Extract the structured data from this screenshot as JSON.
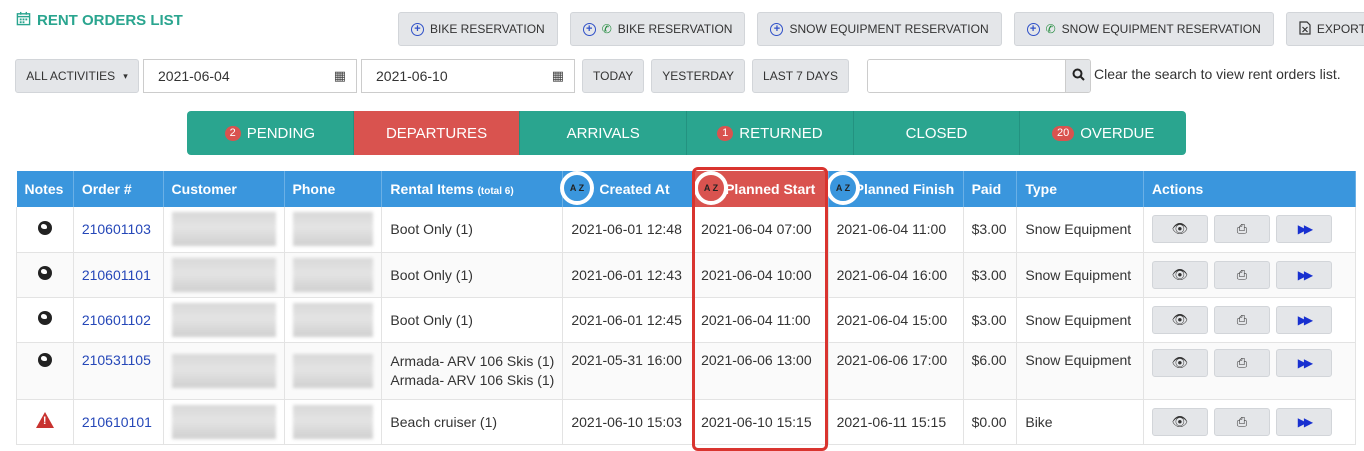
{
  "header": {
    "title": "RENT ORDERS LIST",
    "title_icon": "calendar-icon"
  },
  "top_actions": [
    {
      "label": "BIKE RESERVATION",
      "icons": [
        "plus-circle-icon"
      ]
    },
    {
      "label": "BIKE RESERVATION",
      "icons": [
        "plus-circle-icon",
        "phone-icon"
      ]
    },
    {
      "label": "SNOW EQUIPMENT RESERVATION",
      "icons": [
        "plus-circle-icon"
      ]
    },
    {
      "label": "SNOW EQUIPMENT RESERVATION",
      "icons": [
        "plus-circle-icon",
        "phone-icon"
      ]
    },
    {
      "label": "EXPORT",
      "icons": [
        "excel-icon"
      ]
    }
  ],
  "filters": {
    "activity_select": "ALL ACTIVITIES",
    "date_from": "2021-06-04",
    "date_to": "2021-06-10",
    "quick": [
      "TODAY",
      "YESTERDAY",
      "LAST 7 DAYS"
    ],
    "search_value": "",
    "search_hint": "Clear the search to view rent orders list."
  },
  "status_tabs": [
    {
      "label": "PENDING",
      "badge": "2",
      "active": false
    },
    {
      "label": "DEPARTURES",
      "badge": "",
      "active": true
    },
    {
      "label": "ARRIVALS",
      "badge": "",
      "active": false
    },
    {
      "label": "RETURNED",
      "badge": "1",
      "active": false
    },
    {
      "label": "CLOSED",
      "badge": "",
      "active": false
    },
    {
      "label": "OVERDUE",
      "badge": "20",
      "active": false
    }
  ],
  "table": {
    "columns": {
      "notes": "Notes",
      "order": "Order #",
      "customer": "Customer",
      "phone": "Phone",
      "rental_items": "Rental Items",
      "rental_items_total": "(total 6)",
      "created_at": "Created At",
      "planned_start": "Planned Start",
      "planned_finish": "Planned Finish",
      "paid": "Paid",
      "type": "Type",
      "actions": "Actions"
    },
    "sort_icon_text": "A Z",
    "rows": [
      {
        "note_icon": "globe-icon",
        "order": "210601103",
        "items": [
          "Boot Only (1)"
        ],
        "created": "2021-06-01 12:48",
        "start": "2021-06-04 07:00",
        "finish": "2021-06-04 11:00",
        "paid": "$3.00",
        "type": "Snow Equipment"
      },
      {
        "note_icon": "globe-icon",
        "order": "210601101",
        "items": [
          "Boot Only (1)"
        ],
        "created": "2021-06-01 12:43",
        "start": "2021-06-04 10:00",
        "finish": "2021-06-04 16:00",
        "paid": "$3.00",
        "type": "Snow Equipment"
      },
      {
        "note_icon": "globe-icon",
        "order": "210601102",
        "items": [
          "Boot Only (1)"
        ],
        "created": "2021-06-01 12:45",
        "start": "2021-06-04 11:00",
        "finish": "2021-06-04 15:00",
        "paid": "$3.00",
        "type": "Snow Equipment"
      },
      {
        "note_icon": "globe-icon",
        "order": "210531105",
        "items": [
          "Armada- ARV 106 Skis (1)",
          "Armada- ARV 106 Skis (1)"
        ],
        "created": "2021-05-31 16:00",
        "start": "2021-06-06 13:00",
        "finish": "2021-06-06 17:00",
        "paid": "$6.00",
        "type": "Snow Equipment"
      },
      {
        "note_icon": "warning-icon",
        "order": "210610101",
        "items": [
          "Beach cruiser (1)"
        ],
        "created": "2021-06-10 15:03",
        "start": "2021-06-10 15:15",
        "finish": "2021-06-11 15:15",
        "paid": "$0.00",
        "type": "Bike"
      }
    ],
    "row_actions": [
      "eye-icon",
      "print-icon",
      "fast-forward-icon"
    ]
  },
  "colors": {
    "teal": "#2aa58f",
    "red": "#d9534f",
    "header_blue": "#3a96dd",
    "link": "#2547b8"
  }
}
